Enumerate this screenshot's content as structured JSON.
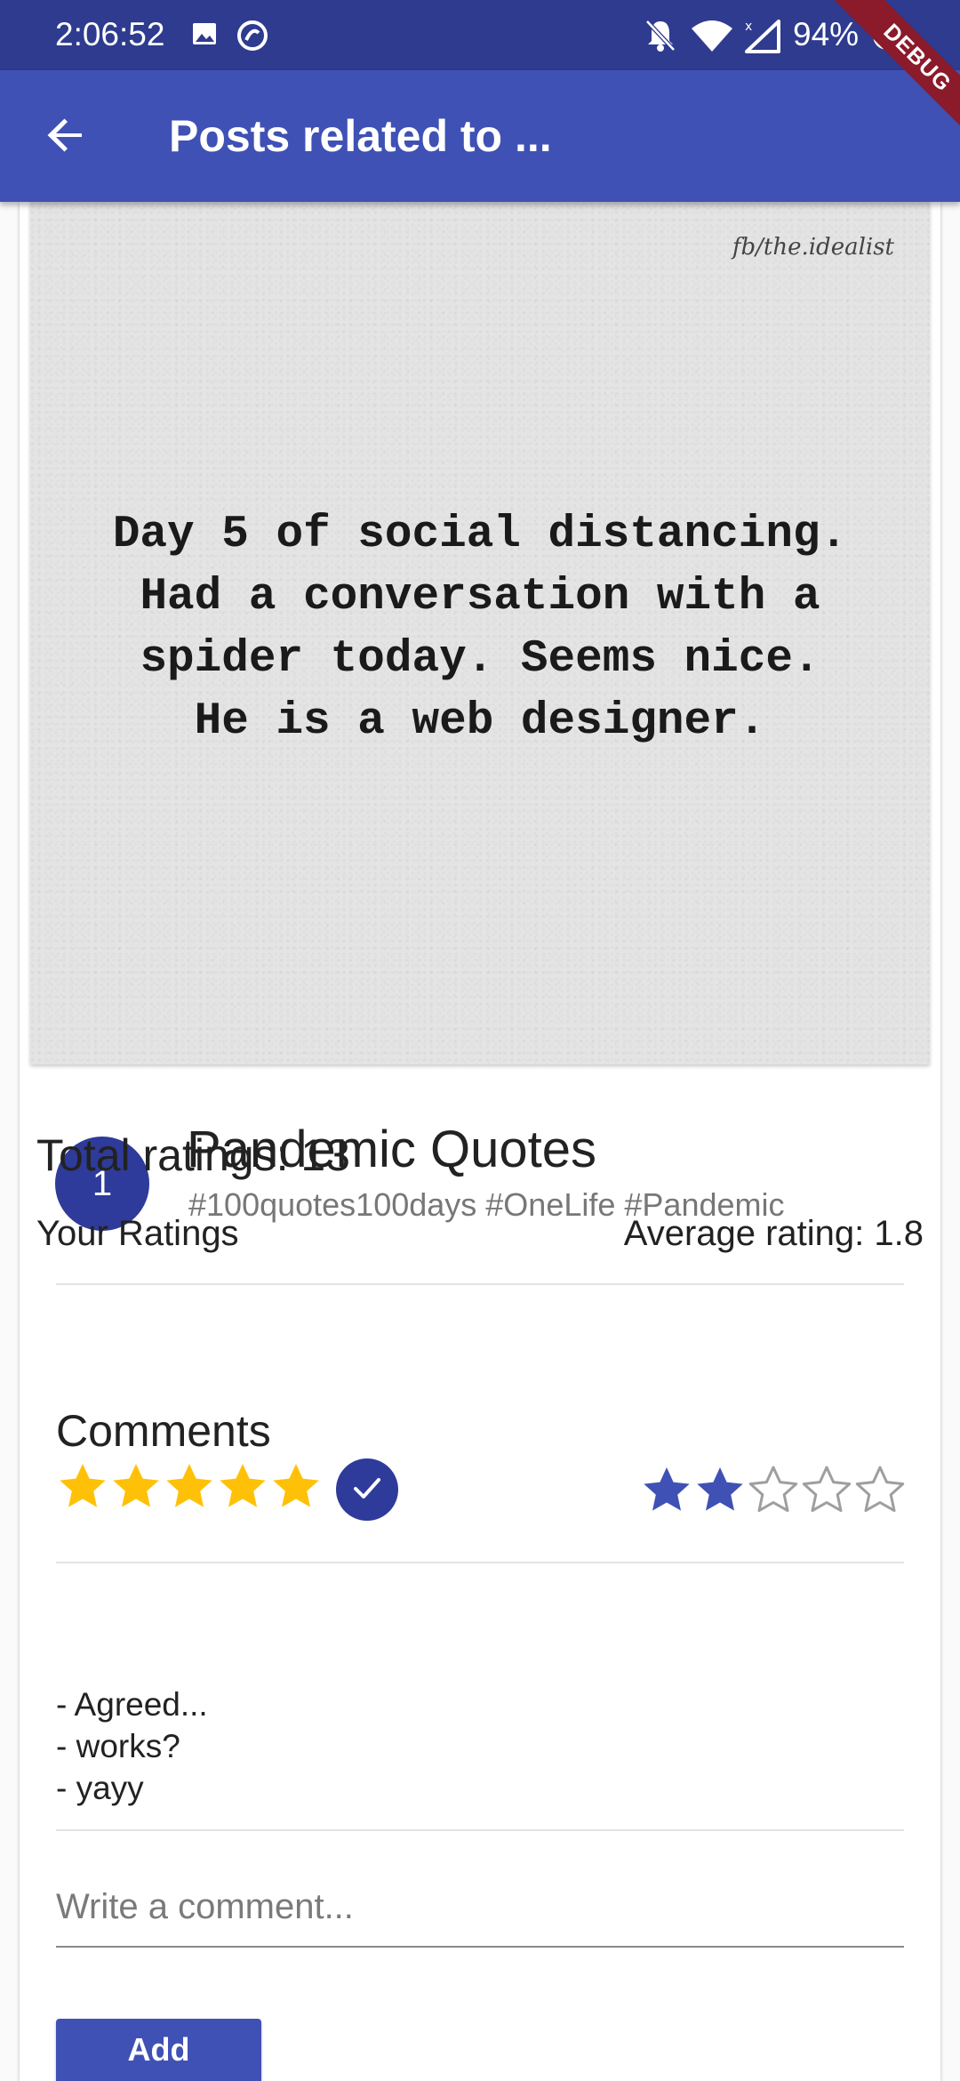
{
  "status_bar": {
    "time": "2:06:52",
    "battery": "94%",
    "icons": [
      "image-icon",
      "at-sign-icon",
      "bell-off-icon",
      "wifi-icon",
      "signal-icon",
      "battery-icon"
    ]
  },
  "app_bar": {
    "title": "Posts related to ...",
    "back_icon": "arrow-left-icon"
  },
  "debug_banner": "DEBUG",
  "post": {
    "image": {
      "watermark": "fb/the.idealist",
      "quote": "Day 5 of social distancing.\nHad a conversation with a\nspider today. Seems nice.\nHe is a web designer."
    },
    "rank": "1",
    "title": "Pandemic Quotes",
    "tags": "#100quotes100days #OneLife #Pandemic"
  },
  "ratings": {
    "total_label": "Total ratings: 13",
    "your_label": "Your Ratings",
    "your_value": 5,
    "your_max": 5,
    "average_label": "Average rating: 1.8",
    "average_value": 2,
    "average_max": 5,
    "colors": {
      "your_star": "#ffc107",
      "avg_star": "#3f51b5",
      "avg_star_empty": "#9e9e9e",
      "confirm_button": "#2e3b9a"
    }
  },
  "comments": {
    "heading": "Comments",
    "items": [
      "- Agreed...",
      "- works?",
      "- yayy"
    ]
  },
  "comment_form": {
    "placeholder": "Write a comment...",
    "value": "",
    "add_label": "Add"
  },
  "colors": {
    "primary": "#3f51b5",
    "primary_dark": "#2e3b8e",
    "debug": "#8b1a2b"
  }
}
